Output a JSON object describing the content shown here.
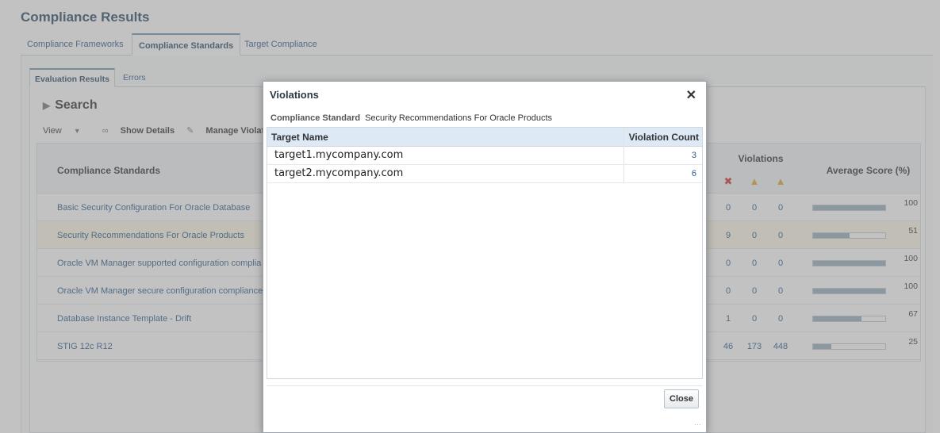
{
  "page": {
    "title": "Compliance Results"
  },
  "main_tabs": [
    {
      "label": "Compliance Frameworks",
      "selected": false
    },
    {
      "label": "Compliance Standards",
      "selected": true
    },
    {
      "label": "Target Compliance",
      "selected": false
    }
  ],
  "sub_tabs": [
    {
      "label": "Evaluation Results",
      "selected": true
    },
    {
      "label": "Errors",
      "selected": false
    }
  ],
  "search": {
    "label": "Search"
  },
  "toolbar": {
    "view_label": "View",
    "show_details_label": "Show Details",
    "manage_violations_label": "Manage Violation"
  },
  "table": {
    "col_name": "Compliance Standards",
    "col_violations": "Violations",
    "col_score": "Average Score (%)",
    "rows": [
      {
        "name": "Basic Security Configuration For Oracle Database",
        "critical": "0",
        "warning": "0",
        "minor": "0",
        "score": 100,
        "score_label": "100",
        "highlighted": false
      },
      {
        "name": "Security Recommendations For Oracle Products",
        "critical": "9",
        "warning": "0",
        "minor": "0",
        "score": 51,
        "score_label": "51",
        "highlighted": true
      },
      {
        "name": "Oracle VM Manager supported configuration complia",
        "critical": "0",
        "warning": "0",
        "minor": "0",
        "score": 100,
        "score_label": "100",
        "highlighted": false
      },
      {
        "name": "Oracle VM Manager secure configuration compliance",
        "critical": "0",
        "warning": "0",
        "minor": "0",
        "score": 100,
        "score_label": "100",
        "highlighted": false
      },
      {
        "name": "Database Instance Template - Drift",
        "critical": "1",
        "warning": "0",
        "minor": "0",
        "score": 67,
        "score_label": "67",
        "highlighted": false
      },
      {
        "name": "STIG 12c R12",
        "critical": "46",
        "warning": "173",
        "minor": "448",
        "score": 25,
        "score_label": "25",
        "highlighted": false
      }
    ]
  },
  "dialog": {
    "title": "Violations",
    "standard_label": "Compliance Standard",
    "standard_value": "Security Recommendations For Oracle Products",
    "col_target": "Target Name",
    "col_count": "Violation Count",
    "rows": [
      {
        "target": "target1.mycompany.com",
        "count": "3"
      },
      {
        "target": "target2.mycompany.com",
        "count": "6"
      }
    ],
    "close_label": "Close"
  },
  "colors": {
    "accent": "#2a5a8a",
    "critical": "#d42f2f",
    "warning": "#e4a81f",
    "score_fill": "#97aebe",
    "highlight_row": "#fbf8e6"
  },
  "icons": {
    "search_toggle": "triangle-right-icon",
    "show_details": "glasses-icon",
    "manage_violations": "pencil-icon",
    "critical": "x-circle-icon",
    "warning": "warning-triangle-icon",
    "minor": "minor-warning-icon",
    "close": "close-icon"
  }
}
